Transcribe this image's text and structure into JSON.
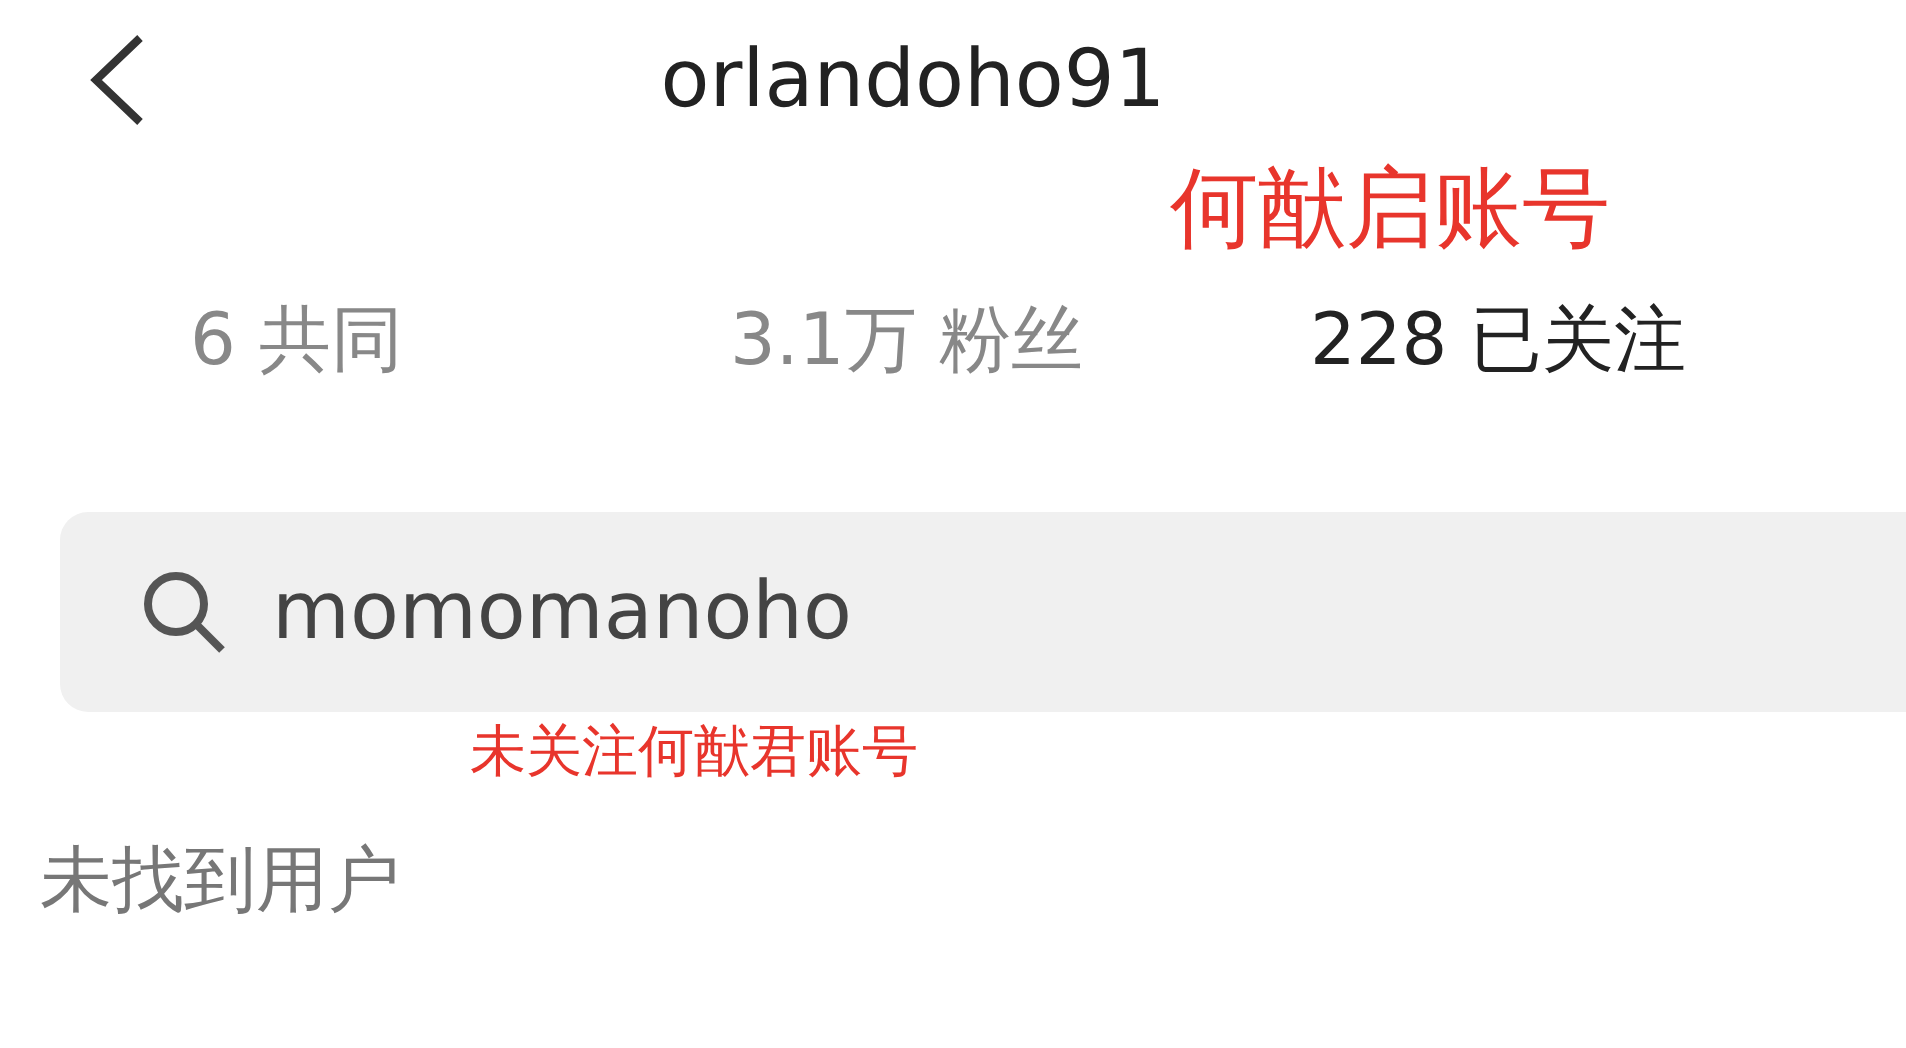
{
  "header": {
    "title": "orlandoho91",
    "note": "何猷启账号"
  },
  "stats": [
    {
      "value": "6",
      "label": "共同",
      "highlight": false
    },
    {
      "value": "3.1万",
      "label": "粉丝",
      "highlight": false
    },
    {
      "value": "228",
      "label": "已关注",
      "highlight": true
    }
  ],
  "search": {
    "value": "momomanoho",
    "note": "未关注何猷君账号"
  },
  "result": "未找到用户"
}
